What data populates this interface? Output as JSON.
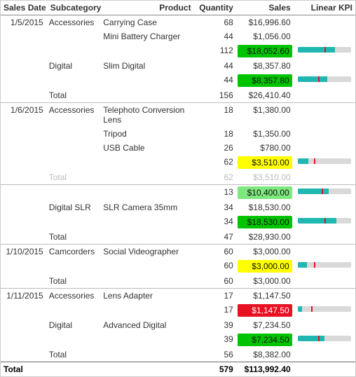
{
  "headers": {
    "date": "Sales Date",
    "subcat": "Subcategory",
    "product": "Product",
    "qty": "Quantity",
    "sales": "Sales",
    "kpi": "Linear KPI"
  },
  "groups": [
    {
      "date": "1/5/2015",
      "subgroups": [
        {
          "subcat": "Accessories",
          "rows": [
            {
              "product": "Carrying Case",
              "qty": "68",
              "sales": "$16,996.60"
            },
            {
              "product": "Mini Battery Charger",
              "qty": "44",
              "sales": "$1,056.00"
            }
          ],
          "subtotal": {
            "qty": "112",
            "sales": "$18,052.60",
            "pill": "green",
            "kpi": {
              "bar": 70,
              "mark": 50
            }
          }
        },
        {
          "subcat": "Digital",
          "rows": [
            {
              "product": "Slim Digital",
              "qty": "44",
              "sales": "$8,357.80"
            }
          ],
          "subtotal": {
            "qty": "44",
            "sales": "$8,357.80",
            "pill": "green",
            "kpi": {
              "bar": 55,
              "mark": 38
            }
          }
        }
      ],
      "total": {
        "label": "Total",
        "qty": "156",
        "sales": "$26,410.40"
      }
    },
    {
      "date": "1/6/2015",
      "subgroups": [
        {
          "subcat": "Accessories",
          "rows": [
            {
              "product": "Telephoto Conversion Lens",
              "qty": "18",
              "sales": "$1,380.00"
            },
            {
              "product": "Tripod",
              "qty": "18",
              "sales": "$1,350.00"
            },
            {
              "product": "USB Cable",
              "qty": "26",
              "sales": "$780.00"
            }
          ],
          "subtotal": {
            "qty": "62",
            "sales": "$3,510.00",
            "pill": "yellow",
            "kpi": {
              "bar": 20,
              "mark": 30
            }
          }
        }
      ],
      "faded_total": {
        "label": "Total",
        "qty": "62",
        "sales": "$3,510.00"
      }
    },
    {
      "date": "",
      "subgroups": [
        {
          "subcat": "",
          "rows": [],
          "subtotal": {
            "qty": "13",
            "sales": "$10,400.00",
            "pill": "lgreen",
            "kpi": {
              "bar": 58,
              "mark": 45
            }
          }
        },
        {
          "subcat": "Digital SLR",
          "rows": [
            {
              "product": "SLR Camera 35mm",
              "qty": "34",
              "sales": "$18,530.00"
            }
          ],
          "subtotal": {
            "qty": "34",
            "sales": "$18,530.00",
            "pill": "green",
            "kpi": {
              "bar": 72,
              "mark": 50
            }
          }
        }
      ],
      "total": {
        "label": "Total",
        "qty": "47",
        "sales": "$28,930.00"
      }
    },
    {
      "date": "1/10/2015",
      "subgroups": [
        {
          "subcat": "Camcorders",
          "rows": [
            {
              "product": "Social Videographer",
              "qty": "60",
              "sales": "$3,000.00"
            }
          ],
          "subtotal": {
            "qty": "60",
            "sales": "$3,000.00",
            "pill": "yellow",
            "kpi": {
              "bar": 18,
              "mark": 30
            }
          }
        }
      ],
      "total": {
        "label": "Total",
        "qty": "60",
        "sales": "$3,000.00"
      }
    },
    {
      "date": "1/11/2015",
      "subgroups": [
        {
          "subcat": "Accessories",
          "rows": [
            {
              "product": "Lens Adapter",
              "qty": "17",
              "sales": "$1,147.50"
            }
          ],
          "subtotal": {
            "qty": "17",
            "sales": "$1,147.50",
            "pill": "red",
            "kpi": {
              "bar": 8,
              "mark": 25
            }
          }
        },
        {
          "subcat": "Digital",
          "rows": [
            {
              "product": "Advanced Digital",
              "qty": "39",
              "sales": "$7,234.50"
            }
          ],
          "subtotal": {
            "qty": "39",
            "sales": "$7,234.50",
            "pill": "green",
            "kpi": {
              "bar": 50,
              "mark": 38
            }
          }
        }
      ],
      "total": {
        "label": "Total",
        "qty": "56",
        "sales": "$8,382.00"
      }
    }
  ],
  "grand_total": {
    "label": "Total",
    "qty": "579",
    "sales": "$113,992.40"
  }
}
